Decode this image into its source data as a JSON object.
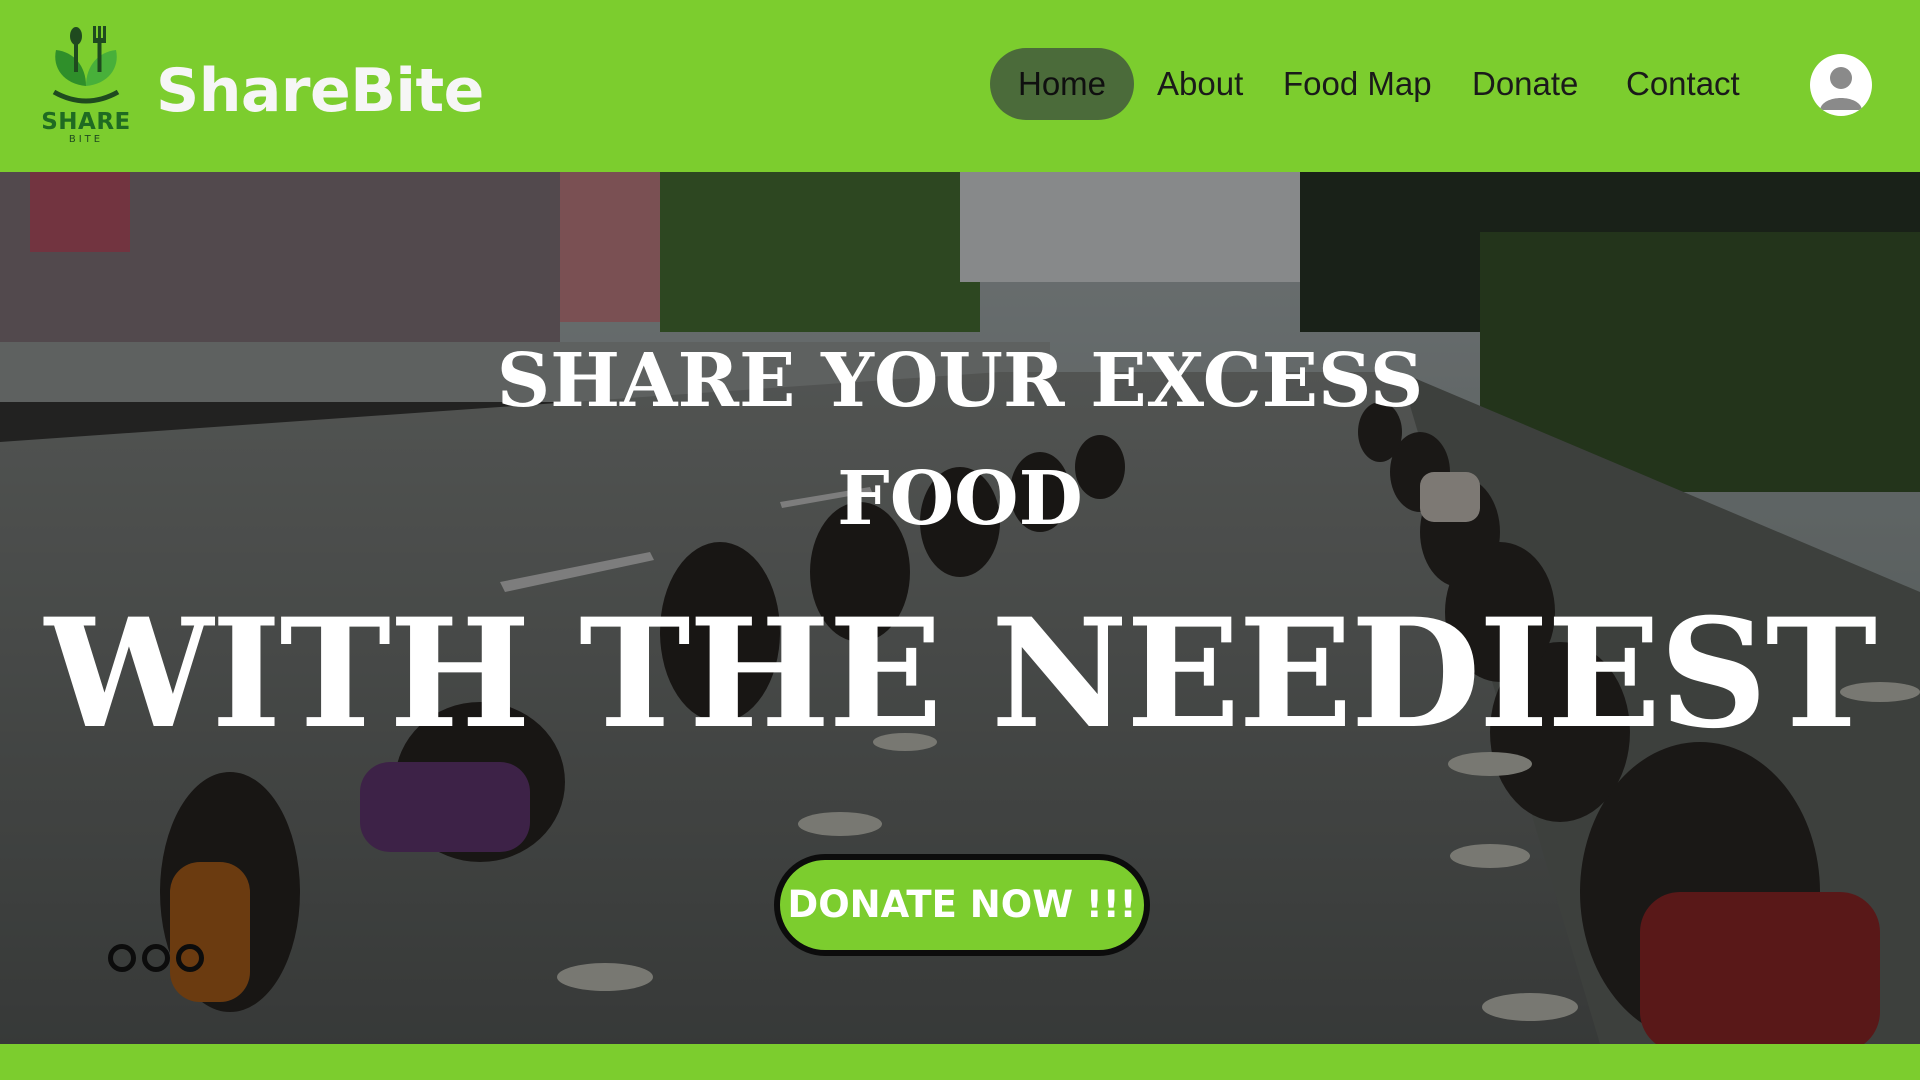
{
  "header": {
    "logo": {
      "share_text": "SHARE",
      "bite_text": "BITE",
      "icon": "fork-spoon-leaf-icon"
    },
    "brand_name": "ShareBite",
    "nav": [
      {
        "label": "Home",
        "active": true
      },
      {
        "label": "About",
        "active": false
      },
      {
        "label": "Food Map",
        "active": false
      },
      {
        "label": "Donate",
        "active": false
      },
      {
        "label": "Contact",
        "active": false
      }
    ],
    "avatar_icon": "user-avatar-icon"
  },
  "hero": {
    "headline_line1": "SHARE YOUR EXCESS",
    "headline_line2": "FOOD",
    "headline_main": "WITH THE NEEDIEST",
    "cta_label": "DONATE NOW !!!",
    "slide_indicators": 3
  },
  "colors": {
    "brand_green": "#7ccd2e",
    "nav_active_bg": "#4b6b3a",
    "logo_green": "#1f6b22",
    "text_light": "#f6f6f6"
  }
}
